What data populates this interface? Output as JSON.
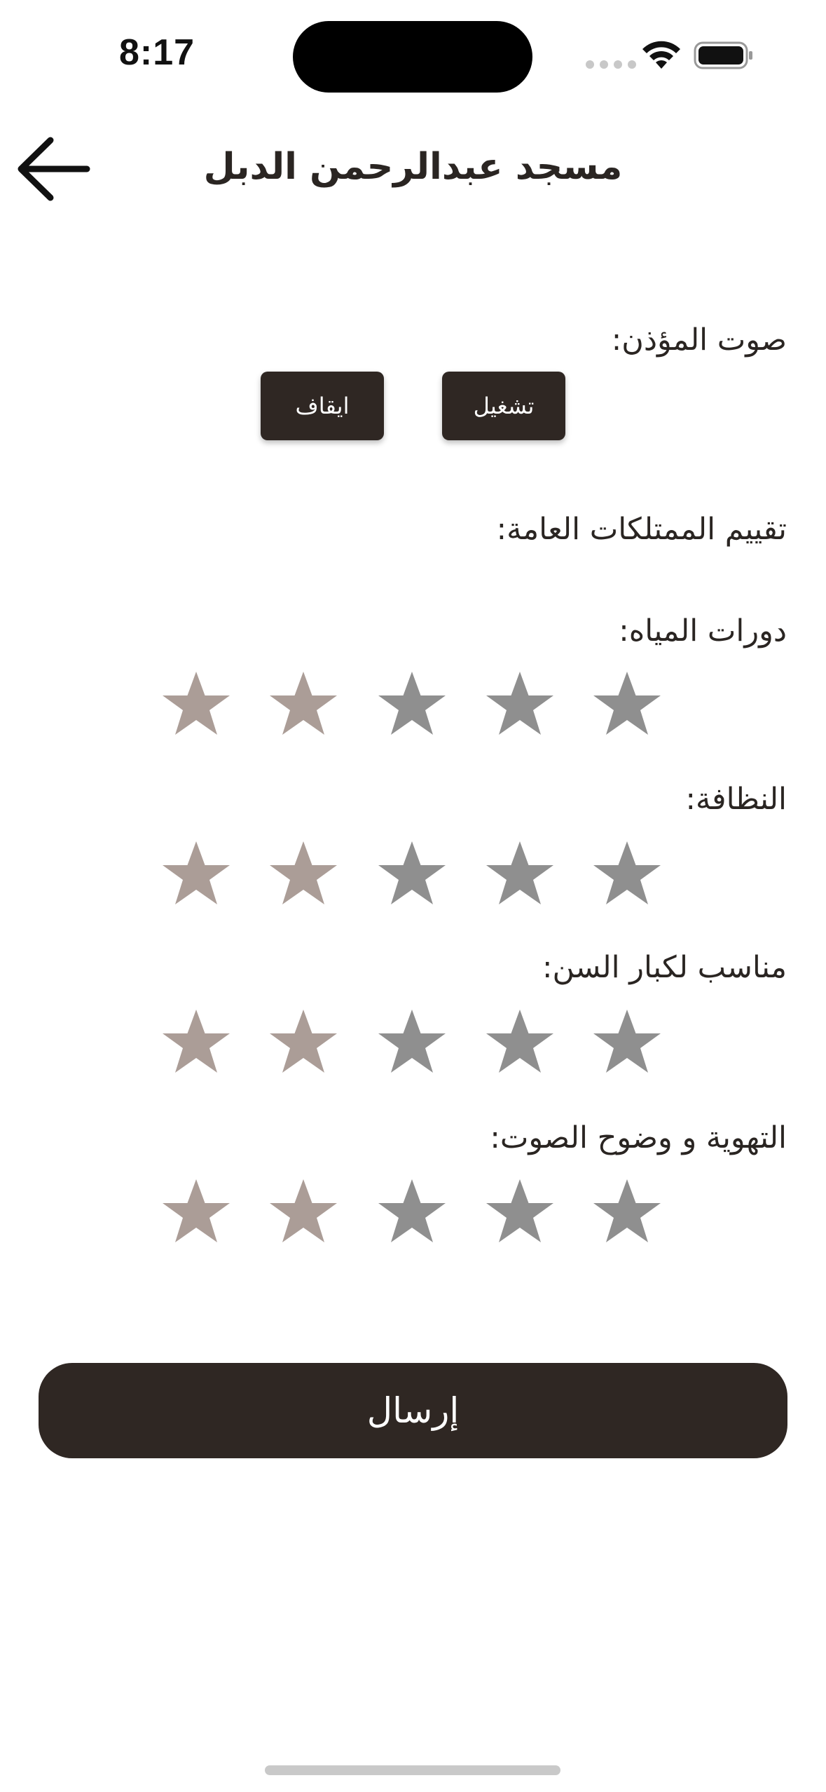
{
  "status_bar": {
    "time": "8:17"
  },
  "header": {
    "title": "مسجد عبدالرحمن الدبل",
    "back_icon": "arrow-left-icon"
  },
  "muezzin": {
    "label": "صوت المؤذن:",
    "play_label": "تشغيل",
    "stop_label": "ايقاف"
  },
  "ratings": {
    "heading": "تقييم الممتلكات العامة:",
    "categories": [
      {
        "label": "دورات المياه:",
        "stars": 5,
        "filled": 2
      },
      {
        "label": "النظافة:",
        "stars": 5,
        "filled": 2
      },
      {
        "label": "مناسب لكبار السن:",
        "stars": 5,
        "filled": 2
      },
      {
        "label": "التهوية و وضوح الصوت:",
        "stars": 5,
        "filled": 2
      }
    ]
  },
  "submit": {
    "label": "إرسال"
  },
  "colors": {
    "primary": "#2f2723",
    "star_selected": "#ab9d97",
    "star_unselected": "#8f8f8f"
  }
}
